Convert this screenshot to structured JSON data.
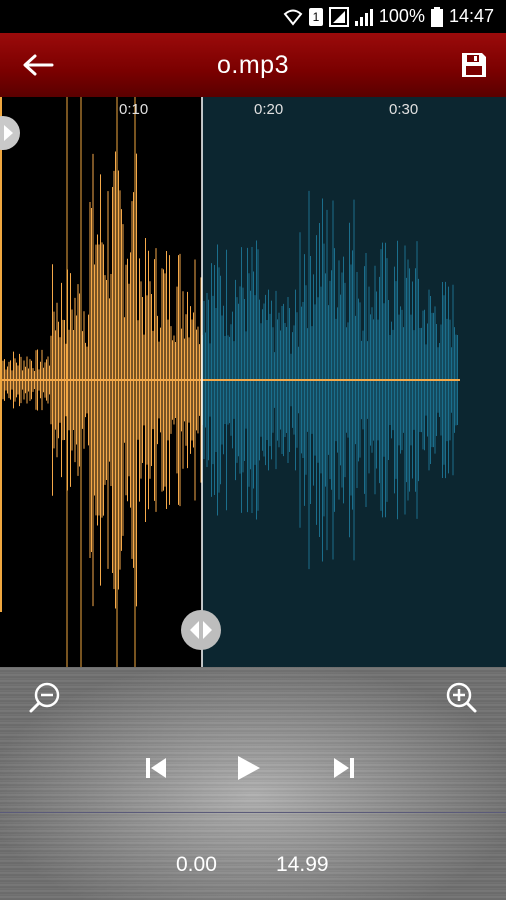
{
  "status_bar": {
    "battery": "100%",
    "time": "14:47",
    "sim": "1"
  },
  "app_bar": {
    "title": "o.mp3"
  },
  "timeline": {
    "marks": [
      "0:10",
      "0:20",
      "0:30"
    ]
  },
  "controls": {
    "start_time": "0.00",
    "end_time": "14.99"
  },
  "colors": {
    "selected_wave": "#f5a94a",
    "unselected_wave": "#1b6e8c",
    "unselected_bg": "#0c2630",
    "app_bar": "#8a0000"
  },
  "icons": {
    "back": "arrow-left-icon",
    "save": "floppy-disk-icon",
    "zoom_out": "zoom-out-icon",
    "zoom_in": "zoom-in-icon",
    "prev": "skip-previous-icon",
    "play": "play-icon",
    "next": "skip-next-icon"
  }
}
